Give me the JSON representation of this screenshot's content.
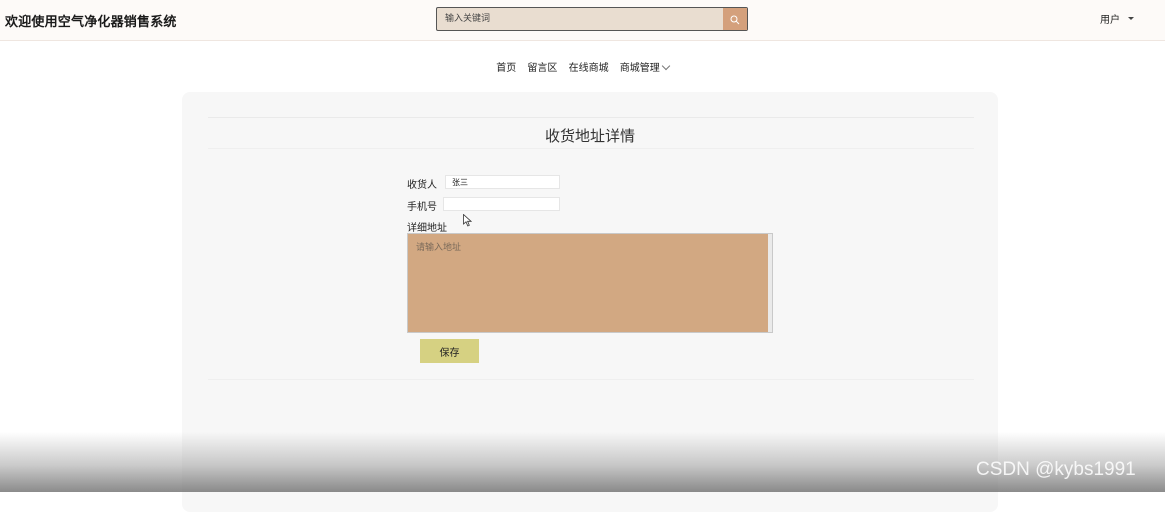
{
  "header": {
    "site_title": "欢迎使用空气净化器销售系统",
    "search_placeholder": "输入关键词",
    "search_icon": "search-icon",
    "user_label": "用户"
  },
  "nav": {
    "items": [
      "首页",
      "留言区",
      "在线商城"
    ],
    "dropdown_label": "商城管理"
  },
  "form": {
    "title": "收货地址详情",
    "receiver_label": "收货人",
    "receiver_value": "张三",
    "phone_label": "手机号",
    "phone_value": "",
    "address_label": "详细地址",
    "address_placeholder": "请输入地址",
    "save_label": "保存"
  },
  "watermark": "CSDN @kybs1991",
  "colors": {
    "accent": "#d4a07c",
    "textarea_bg": "#d2a882",
    "save_button": "#d6d182"
  }
}
